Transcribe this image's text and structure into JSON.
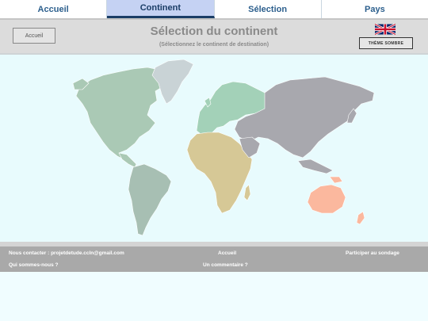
{
  "nav": {
    "tabs": [
      {
        "label": "Accueil"
      },
      {
        "label": "Continent"
      },
      {
        "label": "Sélection"
      },
      {
        "label": "Pays"
      }
    ],
    "active_index": 1
  },
  "header": {
    "home_button": "Accueil",
    "title": "Sélection du continent",
    "subtitle": "(Sélectionnez le continent de destination)",
    "theme_button": "THÈME SOMBRE",
    "language_icon": "uk-flag-icon"
  },
  "map": {
    "continents": [
      {
        "name": "north-america",
        "color": "#aac9b5"
      },
      {
        "name": "greenland",
        "color": "#c9d3d6"
      },
      {
        "name": "south-america",
        "color": "#a7bfb3"
      },
      {
        "name": "europe",
        "color": "#a3d1b8"
      },
      {
        "name": "africa",
        "color": "#d6c896"
      },
      {
        "name": "asia",
        "color": "#a8a8ae"
      },
      {
        "name": "oceania",
        "color": "#fbb89e"
      }
    ]
  },
  "footer": {
    "contact": "Nous contacter : projetdetude.ccln@gmail.com",
    "about": "Qui sommes-nous ?",
    "home": "Accueil",
    "comment": "Un commentaire ?",
    "survey": "Participer au sondage"
  },
  "colors": {
    "accent": "#1a3d66",
    "tab_active_bg": "#c5d2f3",
    "header_bg": "#dcdcdc",
    "footer_bg": "#a9a9a9",
    "map_bg": "#e8fbfd"
  }
}
